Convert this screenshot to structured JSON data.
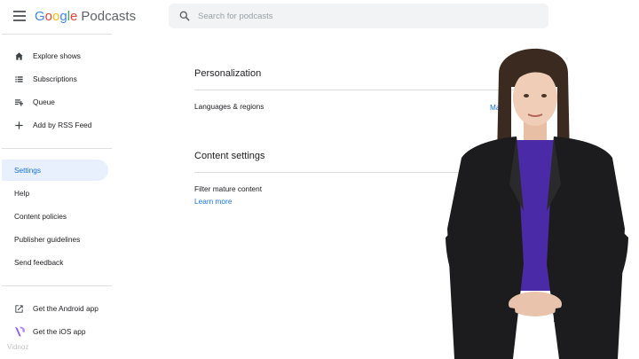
{
  "header": {
    "logo_google": [
      "G",
      "o",
      "o",
      "g",
      "l",
      "e"
    ],
    "logo_product": "Podcasts",
    "search_placeholder": "Search for podcasts"
  },
  "sidebar": {
    "primary": [
      {
        "label": "Explore shows",
        "icon": "home-icon"
      },
      {
        "label": "Subscriptions",
        "icon": "list-icon"
      },
      {
        "label": "Queue",
        "icon": "queue-icon"
      },
      {
        "label": "Add by RSS Feed",
        "icon": "plus-icon"
      }
    ],
    "secondary": [
      {
        "label": "Settings",
        "active": true
      },
      {
        "label": "Help"
      },
      {
        "label": "Content policies"
      },
      {
        "label": "Publisher guidelines"
      },
      {
        "label": "Send feedback"
      }
    ],
    "apps": [
      {
        "label": "Get the Android app",
        "icon": "open-external-icon"
      },
      {
        "label": "Get the iOS app",
        "icon": "vidnoz-logo-icon"
      }
    ]
  },
  "main": {
    "personalization": {
      "title": "Personalization",
      "row_label": "Languages & regions",
      "row_link": "Ma"
    },
    "content_settings": {
      "title": "Content settings",
      "row_label": "Filter mature content",
      "learn_more": "Learn more"
    }
  },
  "watermark": "Vidnoz",
  "colors": {
    "accent": "#1a73e8",
    "active_bg": "#e8f0fe",
    "presenter_sweater": "#4b2aa8",
    "presenter_blazer": "#1c1c1e"
  }
}
